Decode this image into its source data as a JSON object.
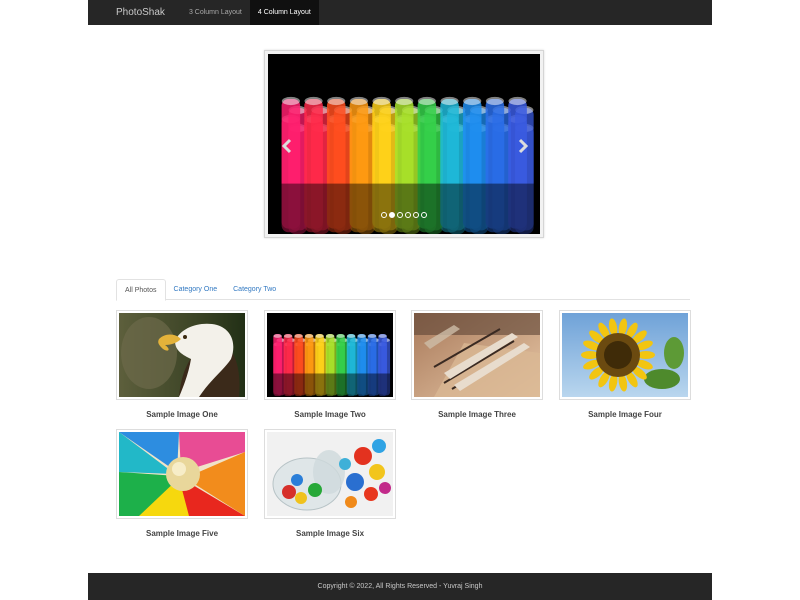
{
  "nav": {
    "brand": "PhotoShak",
    "links": [
      {
        "label": "3 Column Layout",
        "active": false
      },
      {
        "label": "4 Column Layout",
        "active": true
      }
    ]
  },
  "carousel": {
    "slide_count": 6,
    "active_slide": 2
  },
  "tabs": [
    {
      "label": "All Photos",
      "active": true
    },
    {
      "label": "Category One",
      "active": false
    },
    {
      "label": "Category Two",
      "active": false
    }
  ],
  "gallery": [
    {
      "caption": "Sample Image One"
    },
    {
      "caption": "Sample Image Two"
    },
    {
      "caption": "Sample Image Three"
    },
    {
      "caption": "Sample Image Four"
    },
    {
      "caption": "Sample Image Five"
    },
    {
      "caption": "Sample Image Six"
    }
  ],
  "footer": {
    "text": "Copyright © 2022, All Rights Reserved - Yuvraj Singh"
  },
  "colors": {
    "navbar_bg": "#262626",
    "link_color": "#3279c2"
  }
}
